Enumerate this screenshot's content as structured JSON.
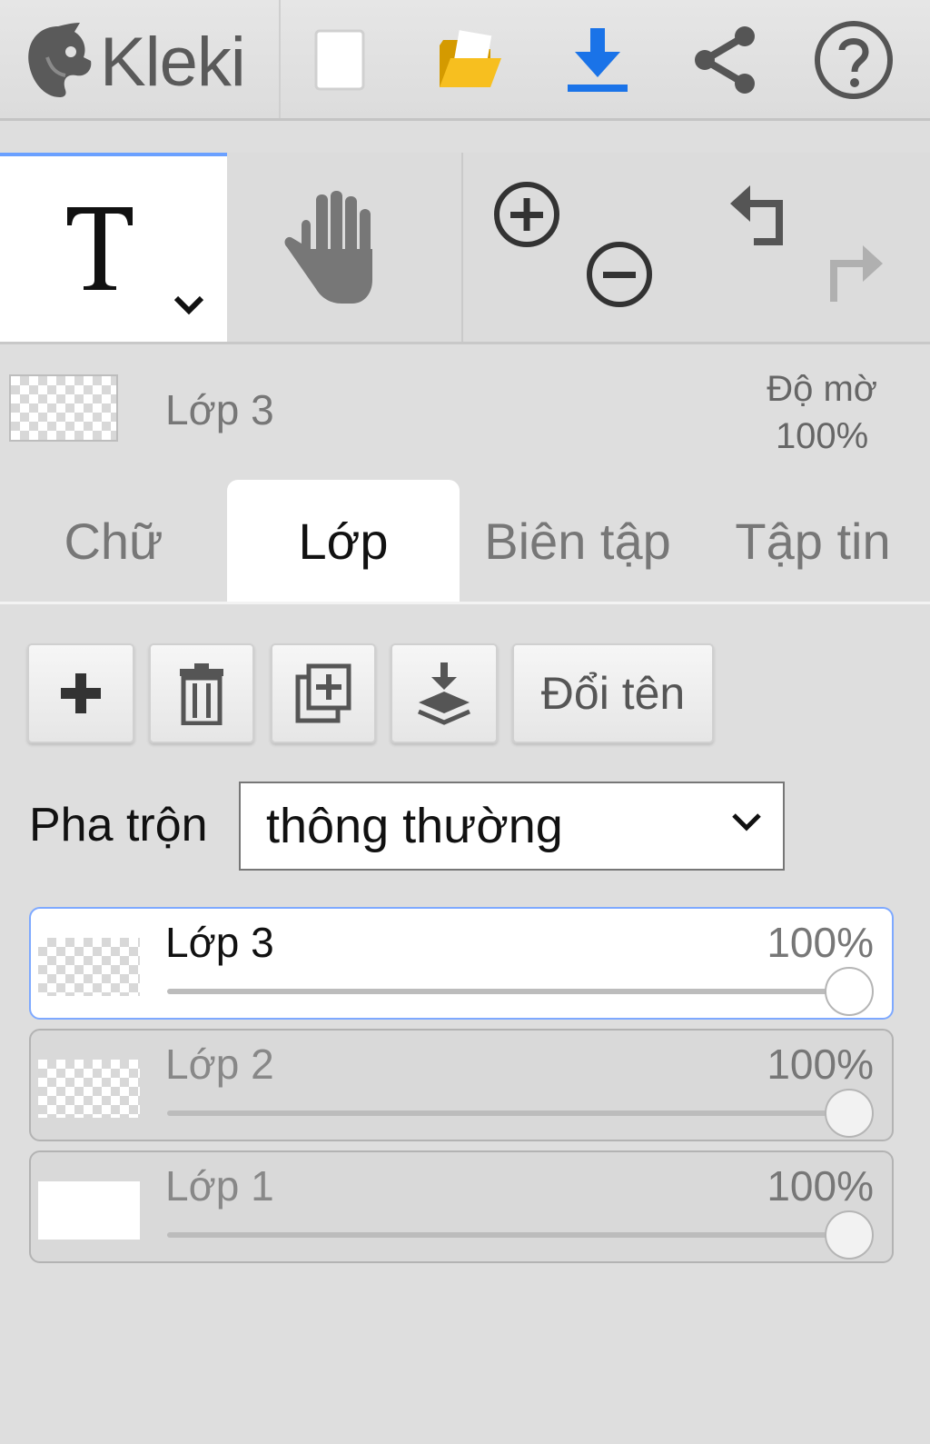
{
  "app": {
    "logo_text": "Kleki"
  },
  "topbar": {
    "icons": [
      "new-image-icon",
      "open-folder-icon",
      "download-icon",
      "share-icon",
      "help-icon"
    ],
    "accent": "#1a73e8"
  },
  "toolbar": {
    "tools": [
      "text-tool-icon",
      "hand-tool-icon",
      "zoom-in-icon",
      "zoom-out-icon",
      "undo-icon",
      "redo-icon"
    ]
  },
  "current_layer": {
    "name": "Lớp 3",
    "opacity_label": "Độ mờ",
    "opacity_value": "100%"
  },
  "tabs": [
    {
      "label": "Chữ",
      "active": false
    },
    {
      "label": "Lớp",
      "active": true
    },
    {
      "label": "Biên tập",
      "active": false
    },
    {
      "label": "Tập tin",
      "active": false
    }
  ],
  "layer_actions": {
    "icons": [
      "add-layer-icon",
      "delete-layer-icon",
      "duplicate-layer-icon",
      "merge-down-icon"
    ],
    "rename_label": "Đổi tên"
  },
  "blend": {
    "label": "Pha trộn",
    "value": "thông thường"
  },
  "layers": [
    {
      "name": "Lớp 3",
      "opacity": "100%",
      "opacity_fraction": 1.0,
      "selected": true
    },
    {
      "name": "Lớp 2",
      "opacity": "100%",
      "opacity_fraction": 1.0,
      "selected": false
    },
    {
      "name": "Lớp 1",
      "opacity": "100%",
      "opacity_fraction": 1.0,
      "selected": false
    }
  ]
}
